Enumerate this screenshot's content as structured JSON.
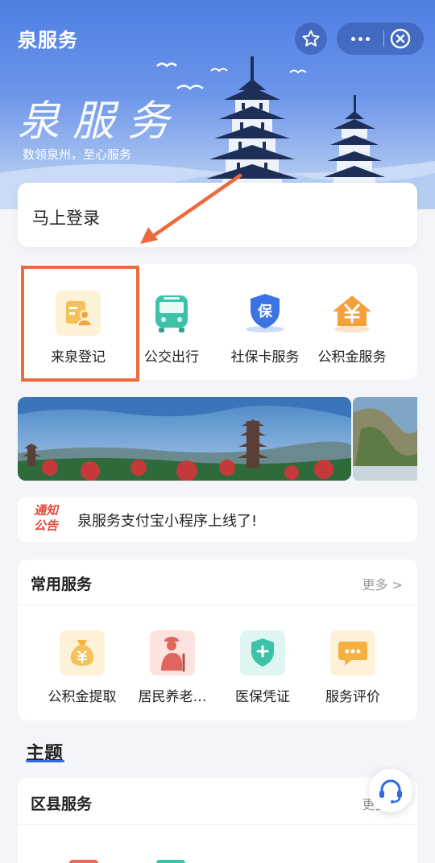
{
  "header": {
    "title": "泉服务",
    "hero_calligraphy": "泉服务",
    "hero_slogan": "数领泉州，至心服务"
  },
  "login": {
    "label": "马上登录"
  },
  "quick_services": [
    {
      "label": "来泉登记",
      "icon": "registration-icon"
    },
    {
      "label": "公交出行",
      "icon": "bus-icon"
    },
    {
      "label": "社保卡服务",
      "icon": "social-security-icon"
    },
    {
      "label": "公积金服务",
      "icon": "housing-fund-icon"
    }
  ],
  "notice": {
    "badge_line1": "通知",
    "badge_line2": "公告",
    "text": "泉服务支付宝小程序上线了!"
  },
  "common_services": {
    "title": "常用服务",
    "more": "更多 >",
    "items": [
      {
        "label": "公积金提取",
        "icon": "money-bag-icon"
      },
      {
        "label": "居民养老…",
        "icon": "elderly-icon"
      },
      {
        "label": "医保凭证",
        "icon": "medical-shield-icon"
      },
      {
        "label": "服务评价",
        "icon": "chat-bubble-icon"
      }
    ]
  },
  "theme": {
    "title": "主题"
  },
  "district": {
    "title": "区县服务",
    "more": "更多 >"
  },
  "colors": {
    "brand_blue": "#4f7fe4",
    "highlight": "#ed6a3c",
    "notice_red": "#e2493b"
  }
}
